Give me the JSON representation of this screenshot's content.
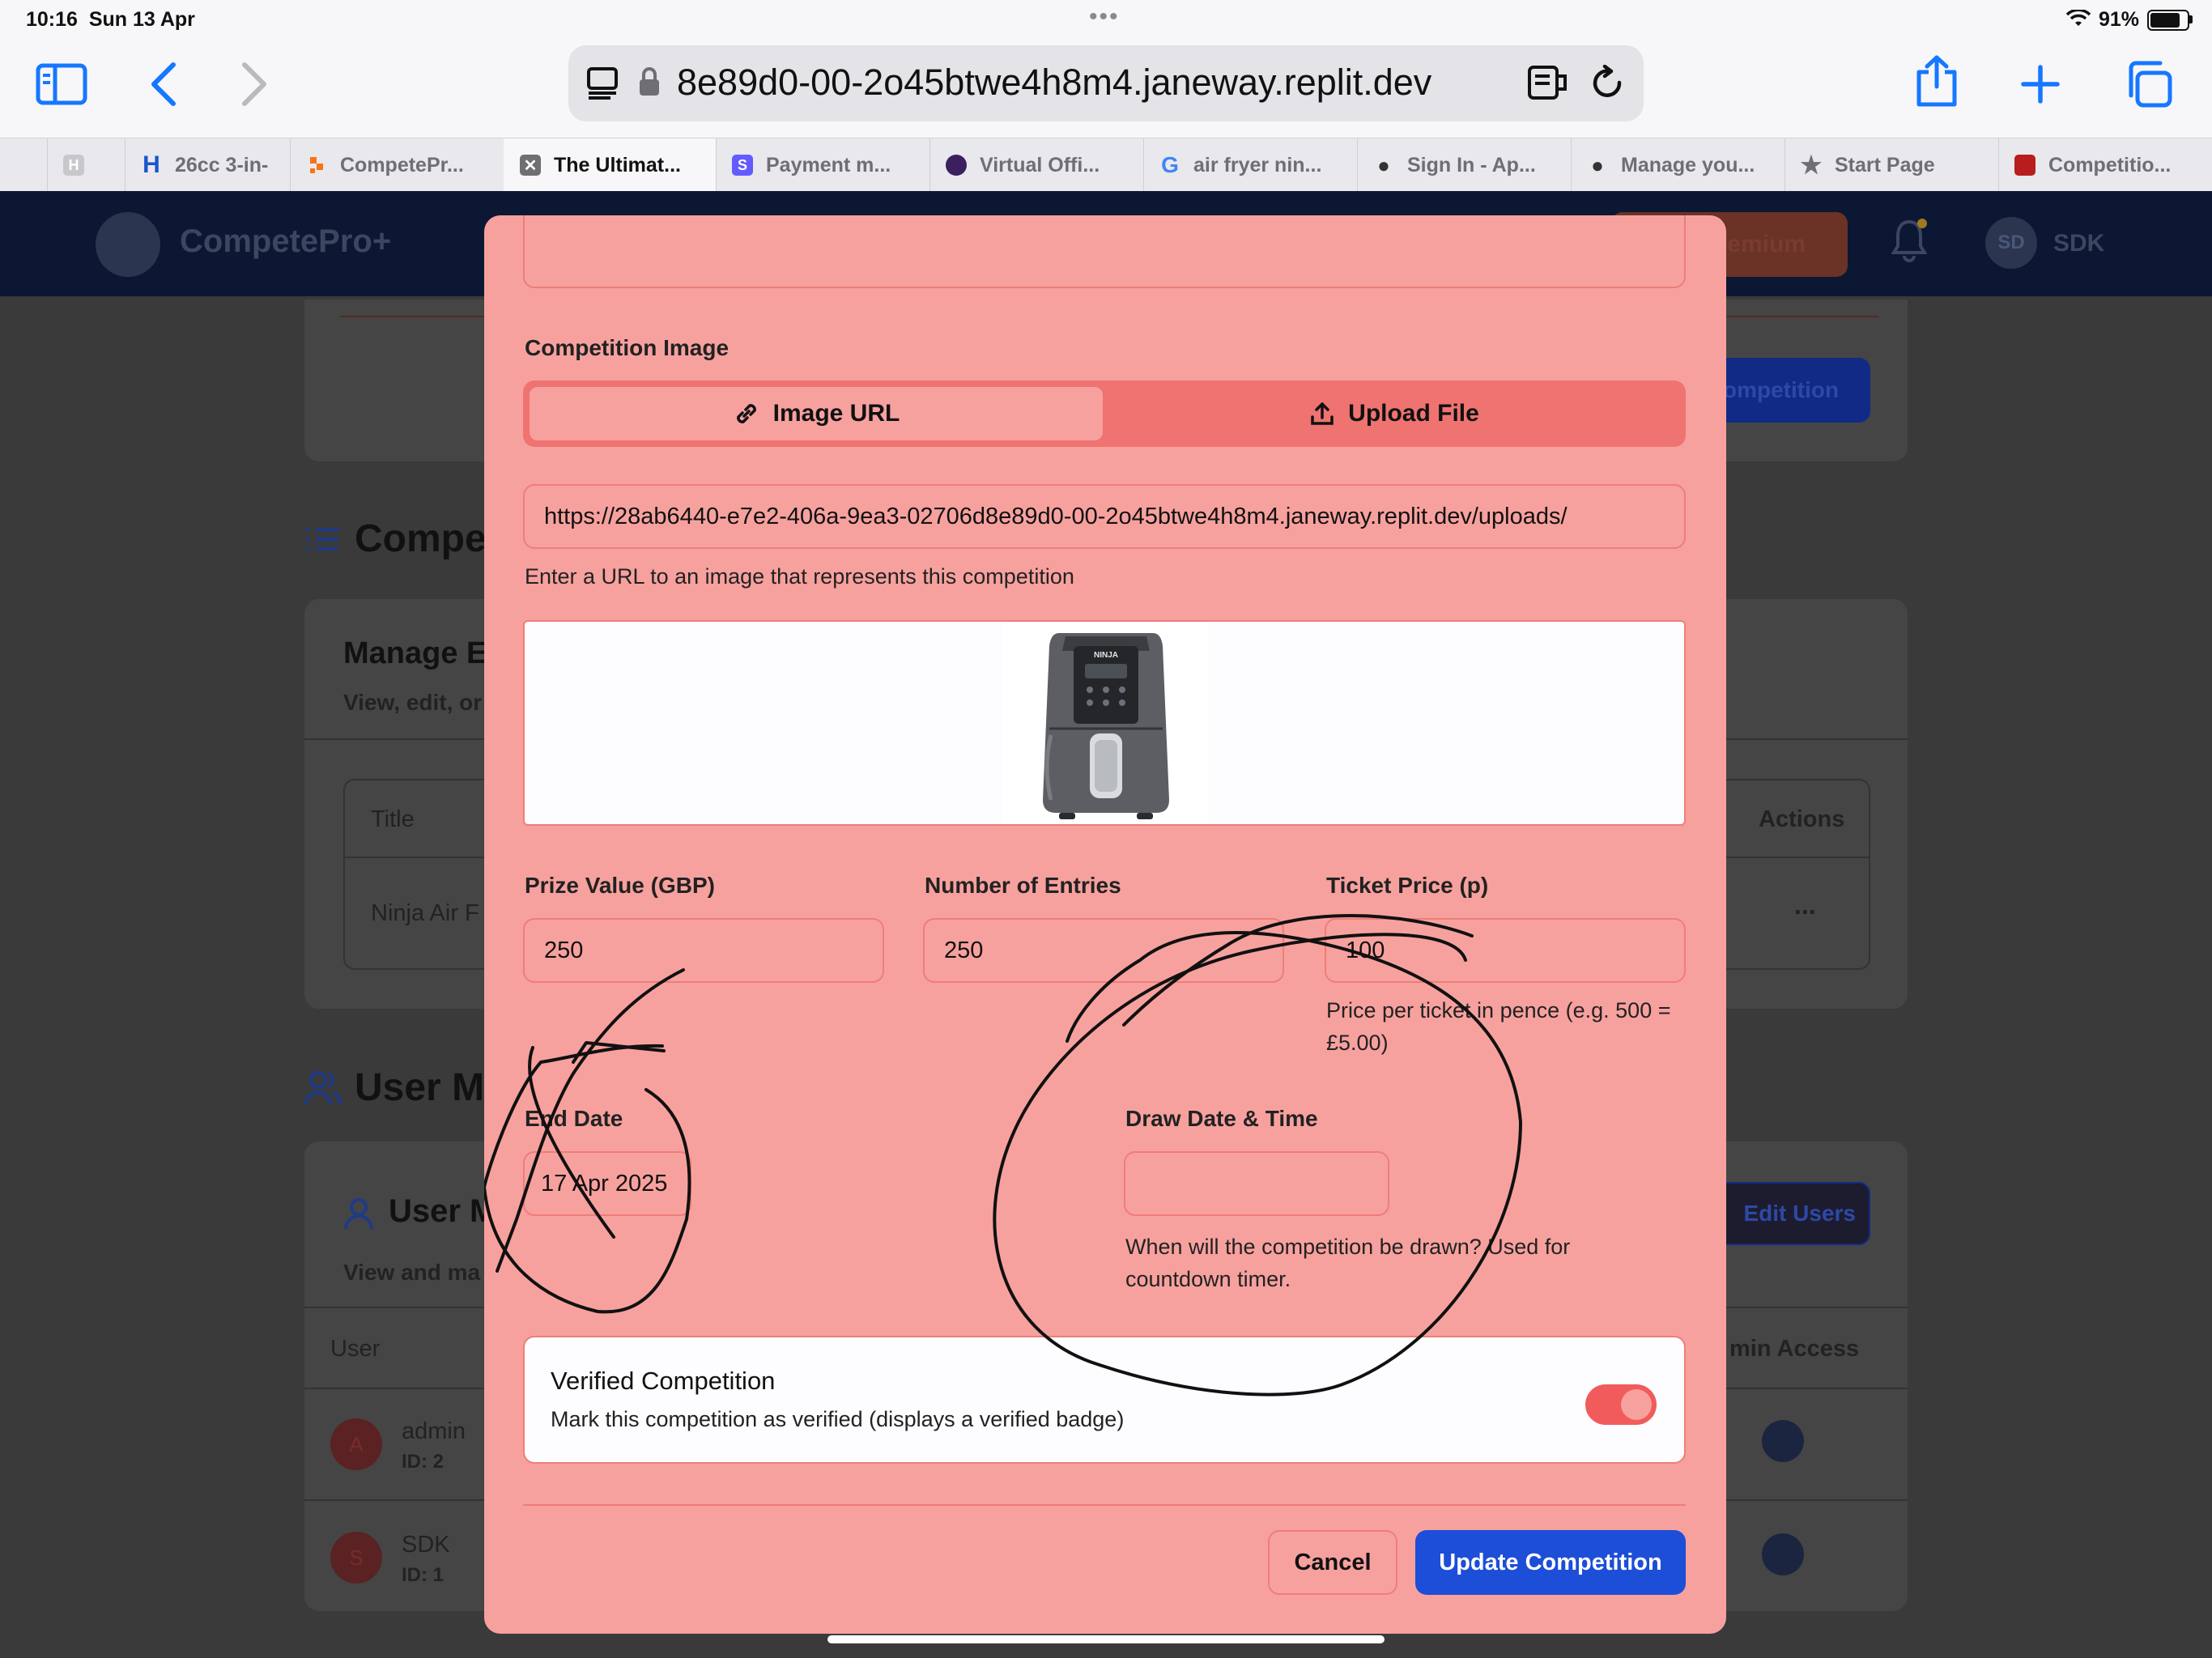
{
  "status_bar": {
    "time": "10:16",
    "date": "Sun 13 Apr",
    "battery": "91%",
    "battery_level": 0.91,
    "dots": "•••"
  },
  "browser": {
    "url": "8e89d0-00-2o45btwe4h8m4.janeway.replit.dev",
    "tabs": [
      {
        "label": "",
        "icon": "blank-favicon"
      },
      {
        "label": "26cc 3-in-",
        "icon": "h-favicon"
      },
      {
        "label": "CompetePr...",
        "icon": "competepro-favicon"
      },
      {
        "label": "The Ultimat...",
        "icon": "close-icon",
        "active": true
      },
      {
        "label": "Payment m...",
        "icon": "stripe-favicon"
      },
      {
        "label": "Virtual Offi...",
        "icon": "virtual-office-favicon"
      },
      {
        "label": "air fryer nin...",
        "icon": "google-favicon"
      },
      {
        "label": "Sign In - Ap...",
        "icon": "apple-favicon"
      },
      {
        "label": "Manage you...",
        "icon": "apple-favicon"
      },
      {
        "label": "Start Page",
        "icon": "star-icon"
      },
      {
        "label": "Competitio...",
        "icon": "competition-favicon"
      }
    ]
  },
  "background_app": {
    "brand": "CompetePro+",
    "premium": "Premium",
    "user_initials": "SD",
    "user_name": "SDK",
    "add_competition": "ompetition",
    "section_competitions": "Compe",
    "manage_title": "Manage E",
    "manage_sub": "View, edit, or",
    "col_title": "Title",
    "col_actions": "Actions",
    "row_title": "Ninja Air F",
    "row_more": "...",
    "section_users": "User M",
    "users_card_title": "User M",
    "users_card_sub": "View and ma",
    "edit_users": "Edit Users",
    "col_user": "User",
    "col_admin": "min Access",
    "users": [
      {
        "avatar": "A",
        "name": "admin",
        "id": "ID: 2"
      },
      {
        "avatar": "S",
        "name": "SDK",
        "id": "ID: 1"
      }
    ]
  },
  "modal": {
    "image_section_label": "Competition Image",
    "tab_image_url": "Image URL",
    "tab_upload_file": "Upload File",
    "image_url_value": "https://28ab6440-e7e2-406a-9ea3-02706d8e89d0-00-2o45btwe4h8m4.janeway.replit.dev/uploads/",
    "image_url_help": "Enter a URL to an image that represents this competition",
    "preview_brand": "NINJA",
    "prize_label": "Prize Value (GBP)",
    "prize_value": "250",
    "entries_label": "Number of Entries",
    "entries_value": "250",
    "ticket_label": "Ticket Price (p)",
    "ticket_value": "100",
    "ticket_help": "Price per ticket in pence (e.g. 500 = £5.00)",
    "end_date_label": "End Date",
    "end_date_value": "17 Apr 2025",
    "draw_label": "Draw Date & Time",
    "draw_value": "",
    "draw_help": "When will the competition be drawn? Used for countdown timer.",
    "verified_title": "Verified Competition",
    "verified_desc": "Mark this competition as verified (displays a verified badge)",
    "verified_on": true,
    "cancel": "Cancel",
    "update": "Update Competition"
  },
  "colors": {
    "modal_bg": "#f7a19e",
    "accent_blue": "#1d4ed8",
    "toggle": "#f15b5b",
    "browser_blue": "#1677ff"
  }
}
